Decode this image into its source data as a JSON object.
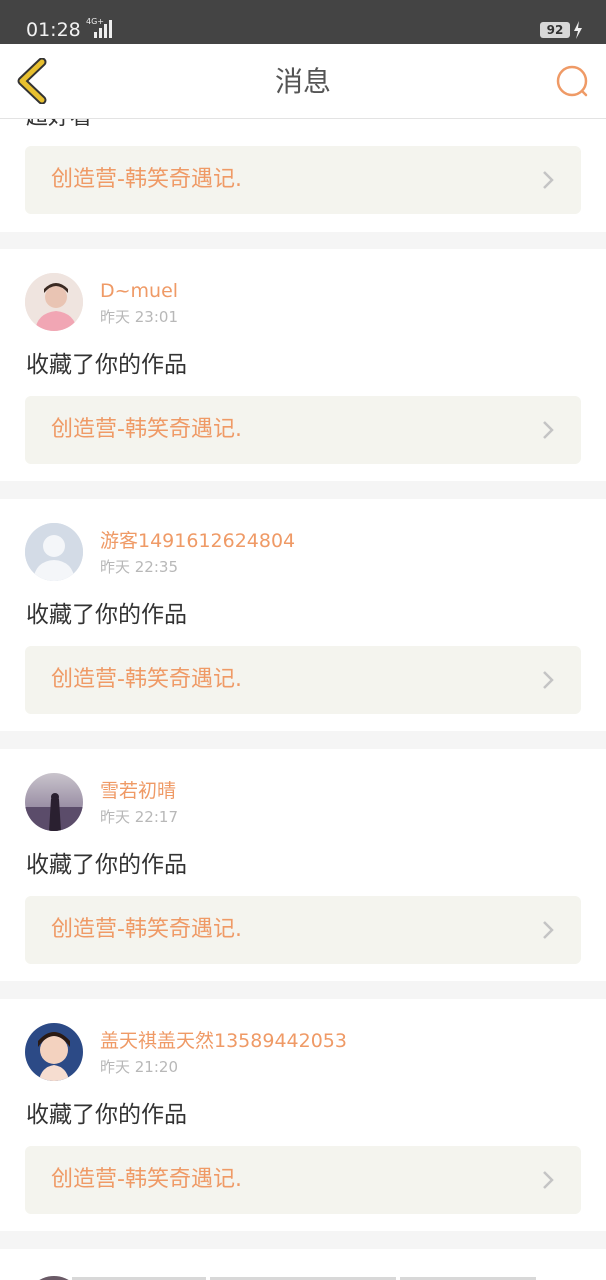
{
  "status": {
    "time": "01:28",
    "network": "4G+",
    "battery": "92"
  },
  "header": {
    "title": "消息"
  },
  "partial_top": {
    "text": "超好看"
  },
  "work_title": "创造营-韩笑奇遇记.",
  "messages": [
    {
      "user": "D~muel",
      "time": "昨天 23:01",
      "text": "收藏了你的作品",
      "work": "创造营-韩笑奇遇记."
    },
    {
      "user": "游客1491612624804",
      "time": "昨天 22:35",
      "text": "收藏了你的作品",
      "work": "创造营-韩笑奇遇记."
    },
    {
      "user": "雪若初晴",
      "time": "昨天 22:17",
      "text": "收藏了你的作品",
      "work": "创造营-韩笑奇遇记."
    },
    {
      "user": "盖天祺盖天然13589442053",
      "time": "昨天 21:20",
      "text": "收藏了你的作品",
      "work": "创造营-韩笑奇遇记."
    }
  ],
  "colors": {
    "accent": "#ef9a66",
    "back_icon": "#e8c030",
    "status_bar": "#444444",
    "link_bg": "#f4f4ee"
  }
}
